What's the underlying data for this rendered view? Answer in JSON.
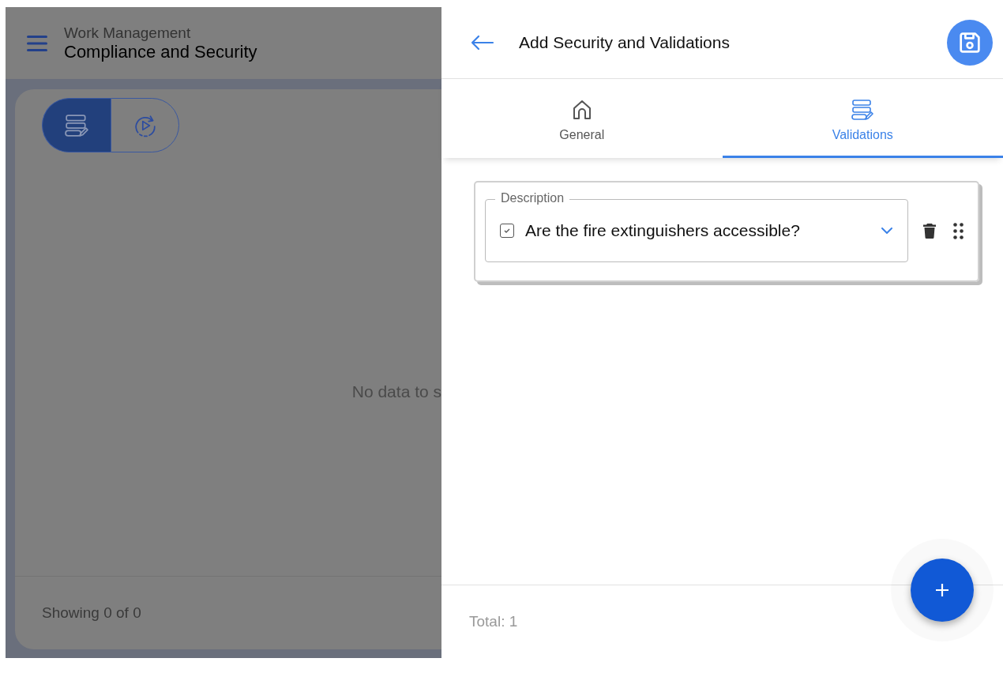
{
  "background_page": {
    "breadcrumb": "Work Management",
    "title": "Compliance and Security",
    "view_toggle": [
      {
        "kind": "form",
        "selected": true
      },
      {
        "kind": "run",
        "selected": false
      }
    ],
    "empty_message": "No data to s",
    "footer": "Showing 0 of 0"
  },
  "panel": {
    "title": "Add Security and Validations",
    "tabs": [
      {
        "label": "General",
        "kind": "home",
        "selected": false
      },
      {
        "label": "Validations",
        "kind": "form",
        "selected": true
      }
    ],
    "validations": [
      {
        "label": "Description",
        "value": "Are the fire extinguishers accessible?",
        "checked": true
      }
    ],
    "total": "Total: 1"
  }
}
